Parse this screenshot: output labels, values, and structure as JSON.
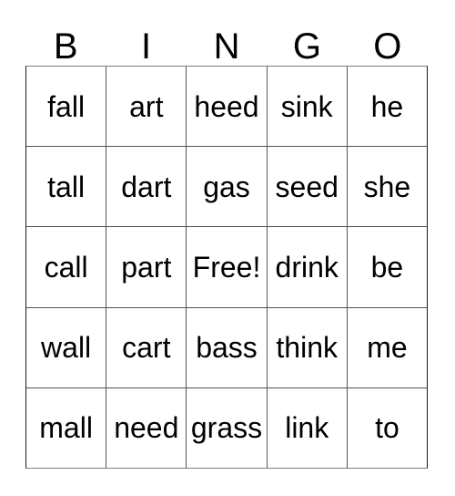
{
  "card": {
    "header": {
      "letters": [
        "B",
        "I",
        "N",
        "G",
        "O"
      ]
    },
    "rows": [
      {
        "cells": [
          "fall",
          "art",
          "heed",
          "sink",
          "he"
        ]
      },
      {
        "cells": [
          "tall",
          "dart",
          "gas",
          "seed",
          "she"
        ]
      },
      {
        "cells": [
          "call",
          "part",
          "Free!",
          "drink",
          "be"
        ]
      },
      {
        "cells": [
          "wall",
          "cart",
          "bass",
          "think",
          "me"
        ]
      },
      {
        "cells": [
          "mall",
          "need",
          "grass",
          "link",
          "to"
        ]
      }
    ],
    "free_space": {
      "row": 2,
      "column": 2,
      "label": "Free!"
    },
    "colors": {
      "background": "#ffffff",
      "text": "#000000",
      "grid_line": "#555555",
      "grid_outer": "#808080"
    }
  }
}
